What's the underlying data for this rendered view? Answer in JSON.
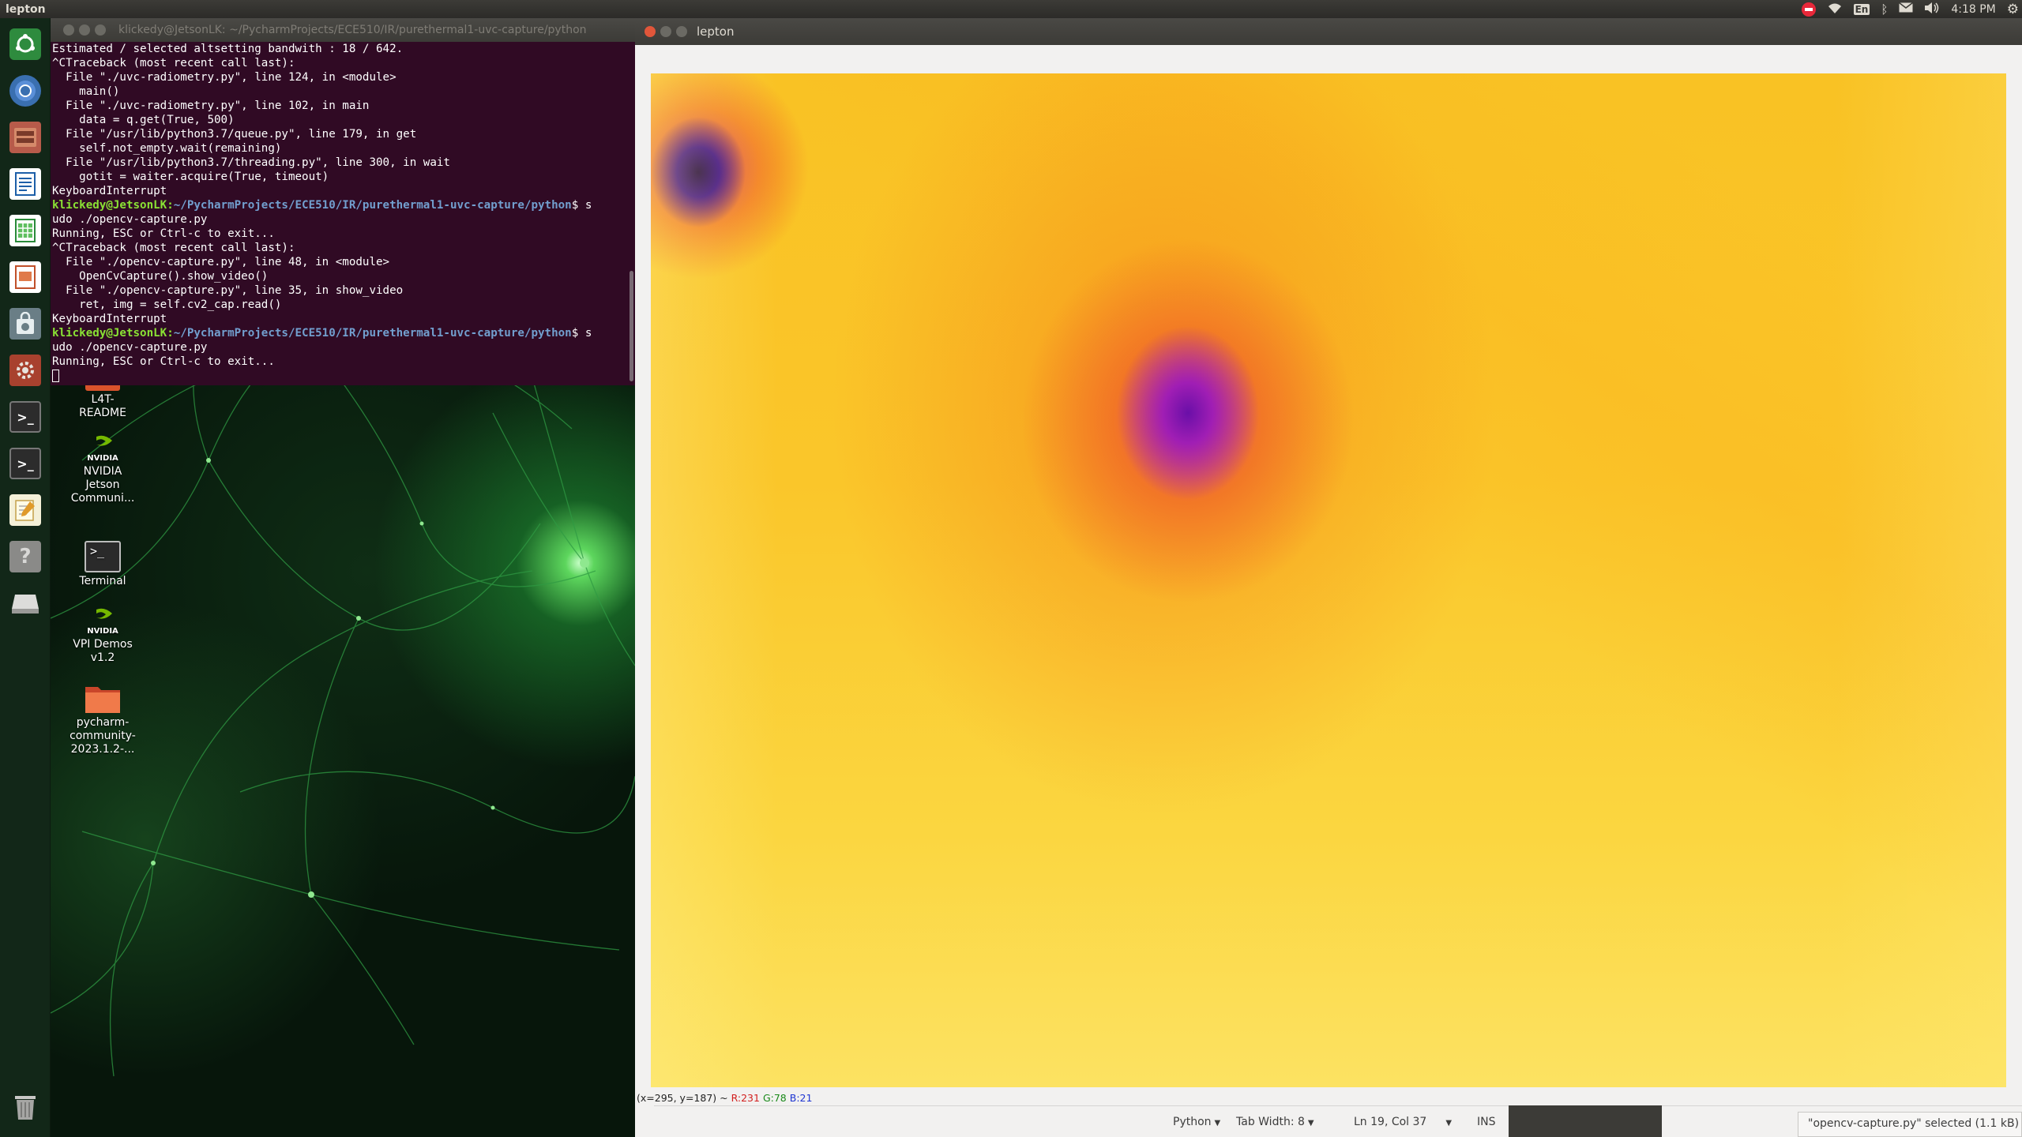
{
  "top_panel": {
    "app_title": "lepton",
    "keyboard_layout": "En",
    "time": "4:18 PM"
  },
  "launcher": {
    "items": [
      "dash-home",
      "chromium-browser",
      "files",
      "writer",
      "calc",
      "impress",
      "software-center",
      "system-settings",
      "terminal",
      "terminal",
      "text-editor",
      "help",
      "removable-drive",
      "trash"
    ]
  },
  "desktop": {
    "icons": [
      {
        "label": "L4T-\nREADME",
        "icon": "folder-icon"
      },
      {
        "label": "NVIDIA\nJetson\nCommuni...",
        "icon": "nvidia-icon",
        "brand": "NVIDIA"
      },
      {
        "label": "Terminal",
        "icon": "terminal-icon"
      },
      {
        "label": "VPI Demos\nv1.2",
        "icon": "nvidia-icon",
        "brand": "NVIDIA"
      },
      {
        "label": "pycharm-\ncommunity-\n2023.1.2-...",
        "icon": "folder-icon"
      }
    ]
  },
  "terminal": {
    "title": "klickedy@JetsonLK: ~/PycharmProjects/ECE510/IR/purethermal1-uvc-capture/python",
    "lines": [
      {
        "t": "Estimated / selected altsetting bandwith : 18 / 642."
      },
      {
        "t": "^CTraceback (most recent call last):"
      },
      {
        "t": "  File \"./uvc-radiometry.py\", line 124, in <module>"
      },
      {
        "t": "    main()"
      },
      {
        "t": "  File \"./uvc-radiometry.py\", line 102, in main"
      },
      {
        "t": "    data = q.get(True, 500)"
      },
      {
        "t": "  File \"/usr/lib/python3.7/queue.py\", line 179, in get"
      },
      {
        "t": "    self.not_empty.wait(remaining)"
      },
      {
        "t": "  File \"/usr/lib/python3.7/threading.py\", line 300, in wait"
      },
      {
        "t": "    gotit = waiter.acquire(True, timeout)"
      },
      {
        "t": "KeyboardInterrupt"
      },
      {
        "prompt": "klickedy@JetsonLK",
        "path": "~/PycharmProjects/ECE510/IR/purethermal1-uvc-capture/python",
        "cmd": "$ s"
      },
      {
        "t": "udo ./opencv-capture.py"
      },
      {
        "t": "Running, ESC or Ctrl-c to exit..."
      },
      {
        "t": "^CTraceback (most recent call last):"
      },
      {
        "t": "  File \"./opencv-capture.py\", line 48, in <module>"
      },
      {
        "t": "    OpenCvCapture().show_video()"
      },
      {
        "t": "  File \"./opencv-capture.py\", line 35, in show_video"
      },
      {
        "t": "    ret, img = self.cv2_cap.read()"
      },
      {
        "t": "KeyboardInterrupt"
      },
      {
        "prompt": "klickedy@JetsonLK",
        "path": "~/PycharmProjects/ECE510/IR/purethermal1-uvc-capture/python",
        "cmd": "$ s"
      },
      {
        "t": "udo ./opencv-capture.py"
      },
      {
        "t": "Running, ESC or Ctrl-c to exit..."
      }
    ]
  },
  "lepton_window": {
    "title": "lepton",
    "pixel_info": {
      "coords": "(x=295, y=187) ~ ",
      "r": "R:231",
      "g": "G:78",
      "b": "B:21"
    }
  },
  "statusbar": {
    "language": "Python",
    "tab_width": "Tab Width: 8",
    "position": "Ln 19, Col 37",
    "mode": "INS",
    "toast": "\"opencv-capture.py\" selected  (1.1 kB)"
  }
}
